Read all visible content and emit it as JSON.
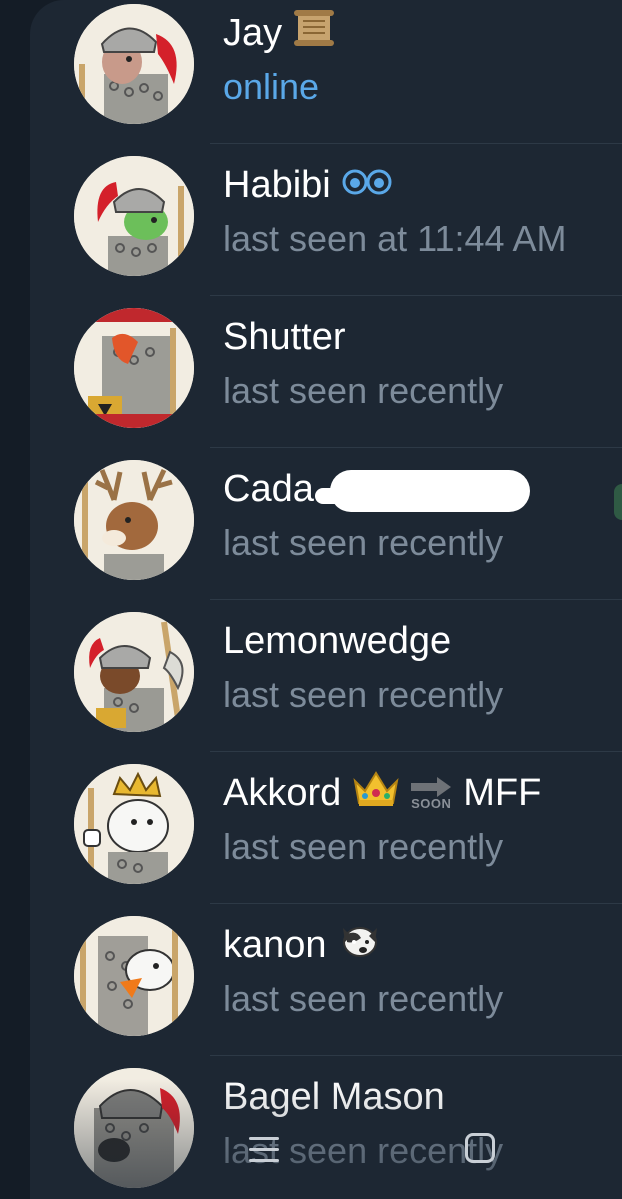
{
  "contacts": [
    {
      "name": "Jay",
      "status": "online",
      "name_emoji": "scroll-icon"
    },
    {
      "name": "Habibi",
      "status": "last seen at 11:44 AM",
      "name_emoji": "eyes-icon"
    },
    {
      "name": "Shutter",
      "status": "last seen recently"
    },
    {
      "name": "Cada",
      "status": "last seen recently"
    },
    {
      "name": "Lemonwedge",
      "status": "last seen recently"
    },
    {
      "name": "Akkord",
      "name_suffix": "MFF",
      "arrow_label": "SOON",
      "status": "last seen recently",
      "name_emoji": "crown-icon"
    },
    {
      "name": "kanon",
      "status": "last seen recently",
      "name_emoji": "dog-face-icon"
    },
    {
      "name": "Bagel Mason",
      "status": "last seen recently"
    }
  ],
  "nav": {
    "menu_icon": "menu-icon",
    "home_icon": "home-icon"
  },
  "colors": {
    "background": "#1d2733",
    "online": "#5aa8e8",
    "status": "#7d8b9a",
    "name": "#ffffff"
  }
}
